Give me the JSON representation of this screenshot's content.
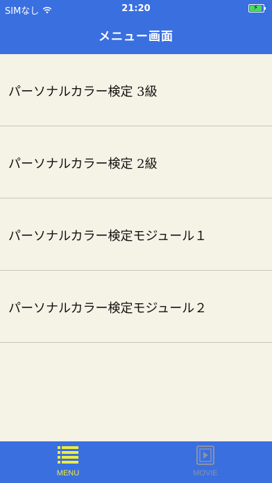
{
  "status_bar": {
    "carrier": "SIMなし",
    "time": "21:20"
  },
  "nav": {
    "title": "メニュー画面"
  },
  "menu_items": [
    {
      "label": "パーソナルカラー検定 3級"
    },
    {
      "label": "パーソナルカラー検定 2級"
    },
    {
      "label": "パーソナルカラー検定モジュール１"
    },
    {
      "label": "パーソナルカラー検定モジュール２"
    }
  ],
  "tab_bar": {
    "tabs": [
      {
        "label": "MENU",
        "icon": "list-icon",
        "active": true
      },
      {
        "label": "MOVIE",
        "icon": "play-icon",
        "active": false
      }
    ]
  },
  "colors": {
    "brand": "#3a6fe0",
    "background": "#f5f2e6",
    "active_tab": "#f0ec3a",
    "inactive_tab": "#8c93a6"
  }
}
